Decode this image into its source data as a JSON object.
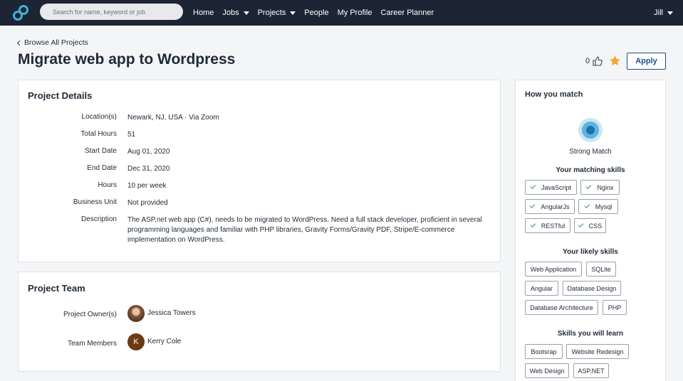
{
  "nav": {
    "search_placeholder": "Search for name, keyword or job",
    "items": [
      {
        "label": "Home",
        "dropdown": false
      },
      {
        "label": "Jobs",
        "dropdown": true
      },
      {
        "label": "Projects",
        "dropdown": true
      },
      {
        "label": "People",
        "dropdown": false
      },
      {
        "label": "My Profile",
        "dropdown": false
      },
      {
        "label": "Career Planner",
        "dropdown": false
      }
    ],
    "user": "Jill",
    "user_dropdown_icon": "chevron-down-icon"
  },
  "header": {
    "breadcrumb": "Browse All Projects",
    "title": "Migrate web app to Wordpress",
    "like_count": "0",
    "apply_label": "Apply",
    "star_color": "#f2a830",
    "accent": "#1c4f8a"
  },
  "details": {
    "title": "Project Details",
    "rows": [
      {
        "label": "Location(s)",
        "value": "Newark, NJ, USA · Via Zoom"
      },
      {
        "label": "Total Hours",
        "value": "51"
      },
      {
        "label": "Start Date",
        "value": "Aug 01, 2020"
      },
      {
        "label": "End Date",
        "value": "Dec 31, 2020"
      },
      {
        "label": "Hours",
        "value": "10 per week"
      },
      {
        "label": "Business Unit",
        "value": "Not provided"
      },
      {
        "label": "Description",
        "value": "The ASP.net web app (C#), needs to be migrated to WordPress. Need a full stack developer, proficient in several programming languages and familiar with PHP libraries, Gravity Forms/Gravity PDF, Stripe/E-commerce implementation on WordPress."
      }
    ]
  },
  "team": {
    "title": "Project Team",
    "owner_label": "Project Owner(s)",
    "owner_name": "Jessica Towers",
    "members_label": "Team Members",
    "member_name": "Kerry Cole",
    "member_initial": "K"
  },
  "match": {
    "title": "How you match",
    "level": "Strong Match",
    "matching_head": "Your matching skills",
    "matching": [
      "JavaScript",
      "Nginx",
      "AngularJs",
      "Mysql",
      "RESTful",
      "CSS"
    ],
    "likely_head": "Your likely skills",
    "likely": [
      "Web Application",
      "SQLite",
      "Angular",
      "Database Design",
      "Database Architecture",
      "PHP"
    ],
    "learn_head": "Skills you will learn",
    "learn": [
      "Bootsrap",
      "Website Redesign",
      "Web Design",
      "ASP.NET"
    ]
  }
}
